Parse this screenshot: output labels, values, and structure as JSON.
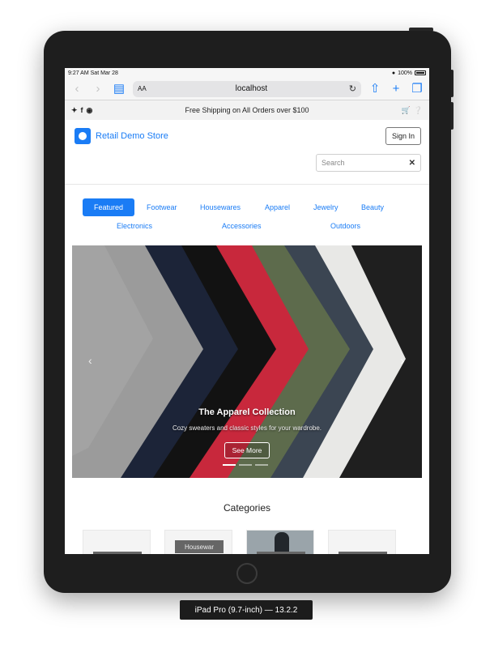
{
  "status_bar": {
    "time": "9:27 AM",
    "date": "Sat Mar 28",
    "battery": "100%"
  },
  "browser": {
    "text_size_label": "AA",
    "url": "localhost",
    "icons": [
      "back-icon",
      "forward-icon",
      "bookmarks-icon",
      "reload-icon",
      "share-icon",
      "new-tab-icon",
      "tabs-icon"
    ]
  },
  "promo_bar": {
    "message": "Free Shipping on All Orders over $100",
    "social_icons": [
      "twitter-icon",
      "facebook-icon",
      "instagram-icon"
    ],
    "action_icons": [
      "cart-icon",
      "help-icon"
    ]
  },
  "header": {
    "store_name": "Retail Demo Store",
    "sign_in_label": "Sign In",
    "search_placeholder": "Search"
  },
  "nav": {
    "items": [
      "Featured",
      "Footwear",
      "Housewares",
      "Apparel",
      "Jewelry",
      "Beauty",
      "Electronics",
      "Accessories",
      "Outdoors"
    ],
    "active": "Featured"
  },
  "hero": {
    "title": "The Apparel Collection",
    "subtitle": "Cozy sweaters and classic styles for your wardrobe.",
    "button_label": "See More",
    "slide_count": 3,
    "active_slide": 1
  },
  "categories": {
    "title": "Categories",
    "visible_card_labels": [
      "",
      "Housewar",
      "",
      ""
    ]
  },
  "device": {
    "label": "iPad Pro (9.7-inch) — 13.2.2"
  },
  "colors": {
    "accent": "#1a7cf5",
    "device_frame": "#1e1e1e"
  }
}
